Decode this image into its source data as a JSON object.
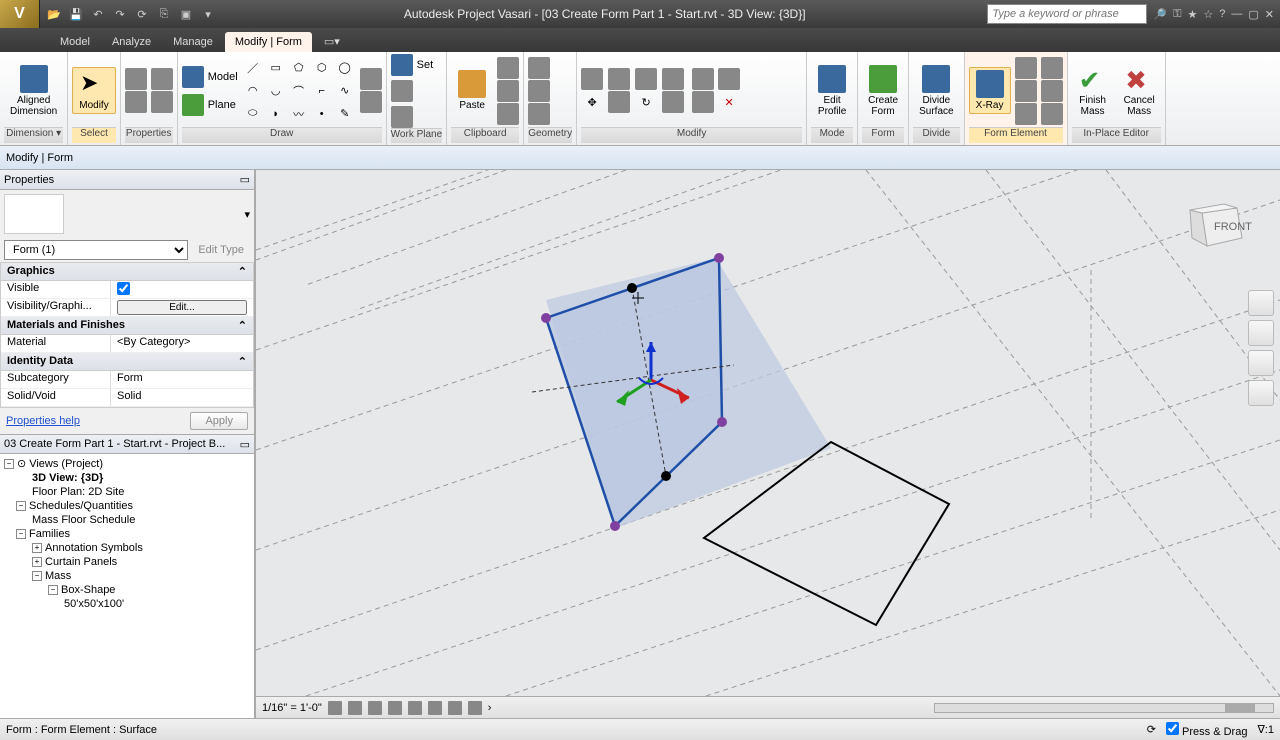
{
  "title": "Autodesk Project Vasari - [03 Create Form Part 1 - Start.rvt - 3D View: {3D}]",
  "search_placeholder": "Type a keyword or phrase",
  "tabs": {
    "model": "Model",
    "analyze": "Analyze",
    "manage": "Manage",
    "modify": "Modify | Form"
  },
  "ribbon": {
    "dimension": {
      "aligned": "Aligned\nDimension",
      "title": "Dimension ▾"
    },
    "select": {
      "modify": "Modify",
      "title": "Select"
    },
    "properties": {
      "title": "Properties"
    },
    "draw": {
      "model": "Model",
      "plane": "Plane",
      "title": "Draw"
    },
    "workplane": {
      "set": "Set",
      "title": "Work Plane"
    },
    "clipboard": {
      "paste": "Paste",
      "title": "Clipboard"
    },
    "geometry": {
      "title": "Geometry"
    },
    "modifyp": {
      "title": "Modify"
    },
    "mode": {
      "edit_profile": "Edit\nProfile",
      "title": "Mode"
    },
    "form": {
      "create_form": "Create\nForm",
      "title": "Form"
    },
    "divide": {
      "divide_surface": "Divide\nSurface",
      "title": "Divide"
    },
    "formel": {
      "xray": "X-Ray",
      "title": "Form Element"
    },
    "editor": {
      "finish": "Finish\nMass",
      "cancel": "Cancel\nMass",
      "title": "In-Place Editor"
    }
  },
  "options_bar": "Modify | Form",
  "properties": {
    "title": "Properties",
    "selector": "Form (1)",
    "edit_type": "Edit Type",
    "groups": {
      "graphics": "Graphics",
      "materials": "Materials and Finishes",
      "identity": "Identity Data"
    },
    "rows": {
      "visible": {
        "k": "Visible",
        "v": true
      },
      "visgraph": {
        "k": "Visibility/Graphi...",
        "v": "Edit..."
      },
      "material": {
        "k": "Material",
        "v": "<By Category>"
      },
      "subcat": {
        "k": "Subcategory",
        "v": "Form"
      },
      "solidvoid": {
        "k": "Solid/Void",
        "v": "Solid"
      }
    },
    "help": "Properties help",
    "apply": "Apply"
  },
  "browser": {
    "title": "03 Create Form Part 1 - Start.rvt - Project B...",
    "views": "Views (Project)",
    "view3d": "3D View: {3D}",
    "floorplan": "Floor Plan: 2D Site",
    "schedules": "Schedules/Quantities",
    "massfloor": "Mass Floor Schedule",
    "families": "Families",
    "annot": "Annotation Symbols",
    "curtain": "Curtain Panels",
    "mass": "Mass",
    "boxshape": "Box-Shape",
    "boxdim": "50'x50'x100'"
  },
  "viewbar": {
    "scale": "1/16\" = 1'-0\""
  },
  "status": {
    "left": "Form : Form Element : Surface",
    "press": "Press & Drag",
    "filter": "1"
  }
}
